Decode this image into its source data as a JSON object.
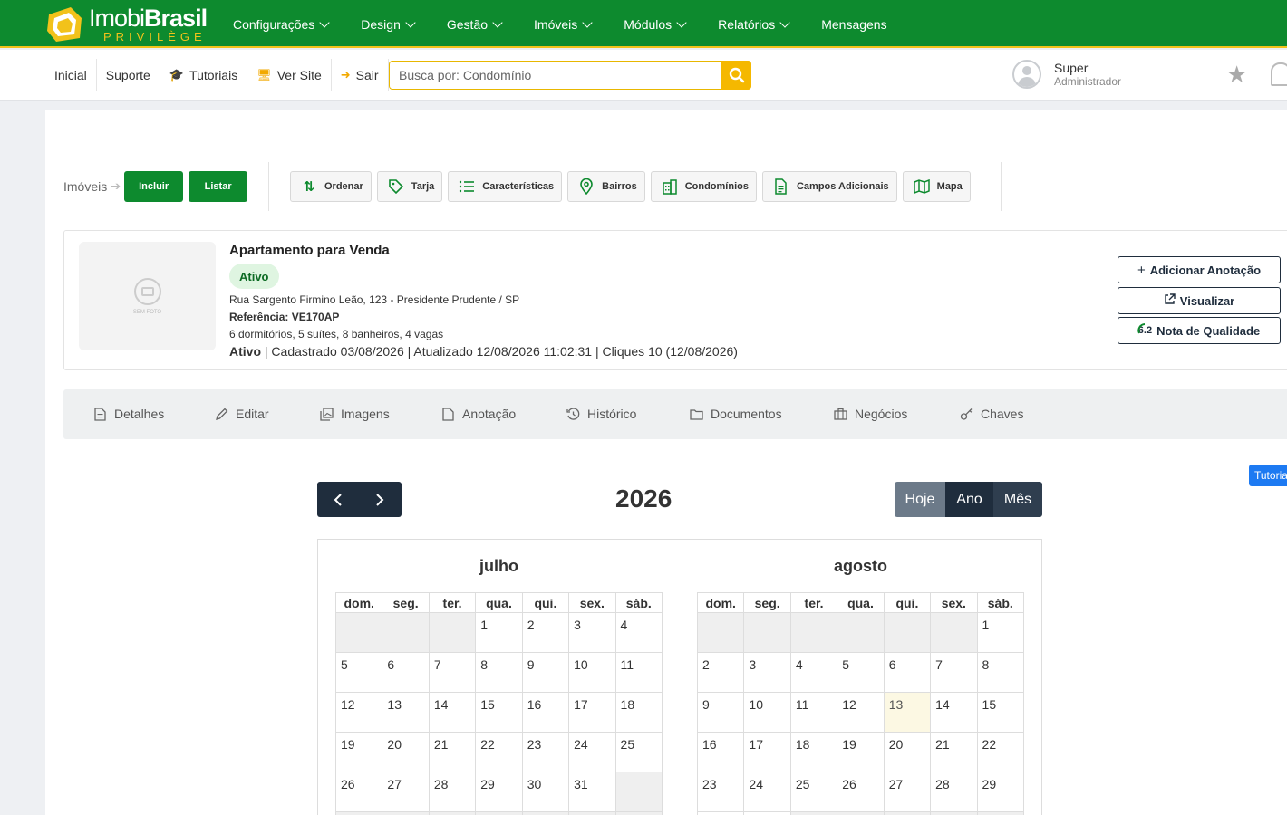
{
  "brand": {
    "name_light": "Imobi",
    "name_bold": "Brasil",
    "tagline": "PRIVILÈGE"
  },
  "main_menu": [
    "Configurações",
    "Design",
    "Gestão",
    "Imóveis",
    "Módulos",
    "Relatórios",
    "Mensagens"
  ],
  "sub_nav": {
    "inicial": "Inicial",
    "suporte": "Suporte",
    "tutoriais": "Tutoriais",
    "ver_site": "Ver Site",
    "sair": "Sair"
  },
  "search": {
    "placeholder": "Busca por: Condomínio",
    "value": ""
  },
  "user": {
    "name": "Super",
    "role": "Administrador"
  },
  "breadcrumb": {
    "label": "Imóveis",
    "incluir": "Incluir",
    "listar": "Listar"
  },
  "tools": [
    "Ordenar",
    "Tarja",
    "Características",
    "Bairros",
    "Condomínios",
    "Campos Adicionais",
    "Mapa"
  ],
  "property": {
    "photo_caption": "SEM FOTO",
    "title": "Apartamento para Venda",
    "status_badge": "Ativo",
    "address": "Rua Sargento Firmino Leão, 123 - Presidente Prudente / SP",
    "reference": "Referência: VE170AP",
    "features": "6 dormitórios, 5 suítes, 8 banheiros, 4 vagas",
    "status_word": "Ativo",
    "meta": " | Cadastrado 03/08/2026 | Atualizado 12/08/2026 11:02:31 | Cliques 10 (12/08/2026)"
  },
  "actions": {
    "add_note": "Adicionar Anotação",
    "view": "Visualizar",
    "quality_score": "6.2",
    "quality": "Nota de Qualidade"
  },
  "tabs": [
    "Detalhes",
    "Editar",
    "Imagens",
    "Anotação",
    "Histórico",
    "Documentos",
    "Negócios",
    "Chaves"
  ],
  "calendar": {
    "year": "2026",
    "view_buttons": [
      "Hoje",
      "Ano",
      "Mês"
    ],
    "tutorial": "Tutorial",
    "weekdays": [
      "dom.",
      "seg.",
      "ter.",
      "qua.",
      "qui.",
      "sex.",
      "sáb."
    ],
    "months": [
      {
        "name": "julho",
        "first_weekday": 3,
        "days": 31,
        "today": null
      },
      {
        "name": "agosto",
        "first_weekday": 6,
        "days": 31,
        "today": 13
      }
    ]
  },
  "colors": {
    "brand_green": "#0d8a2e",
    "brand_yellow": "#f2c21a",
    "dark_navy": "#1f2d3d",
    "today_highlight": "#fcf8e3"
  }
}
